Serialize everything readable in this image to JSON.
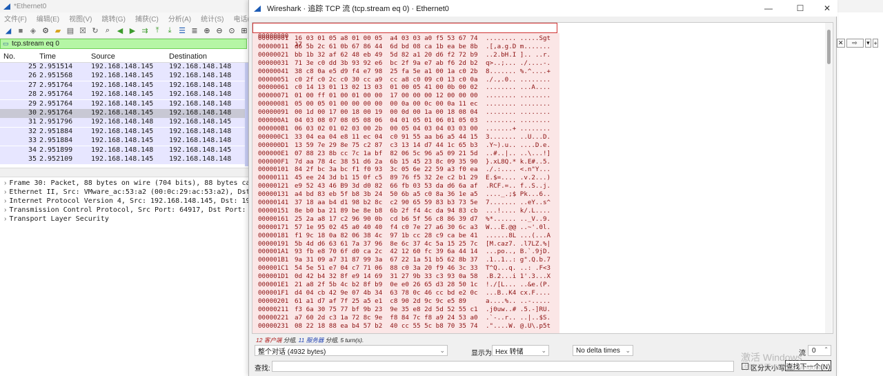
{
  "main": {
    "title": "*Ethernet0",
    "menu": [
      "文件(F)",
      "编辑(E)",
      "视图(V)",
      "跳转(G)",
      "捕获(C)",
      "分析(A)",
      "统计(S)",
      "电话(Y)",
      "无线"
    ],
    "filter": "tcp.stream eq 0",
    "columns": {
      "no": "No.",
      "time": "Time",
      "source": "Source",
      "destination": "Destination"
    },
    "packets": [
      {
        "no": "25",
        "time": "2.951514",
        "src": "192.168.148.145",
        "dst": "192.168.148.148"
      },
      {
        "no": "26",
        "time": "2.951568",
        "src": "192.168.148.145",
        "dst": "192.168.148.148"
      },
      {
        "no": "27",
        "time": "2.951764",
        "src": "192.168.148.145",
        "dst": "192.168.148.148"
      },
      {
        "no": "28",
        "time": "2.951764",
        "src": "192.168.148.145",
        "dst": "192.168.148.148"
      },
      {
        "no": "29",
        "time": "2.951764",
        "src": "192.168.148.145",
        "dst": "192.168.148.148"
      },
      {
        "no": "30",
        "time": "2.951764",
        "src": "192.168.148.145",
        "dst": "192.168.148.148"
      },
      {
        "no": "31",
        "time": "2.951796",
        "src": "192.168.148.148",
        "dst": "192.168.148.145"
      },
      {
        "no": "32",
        "time": "2.951884",
        "src": "192.168.148.145",
        "dst": "192.168.148.148"
      },
      {
        "no": "33",
        "time": "2.951884",
        "src": "192.168.148.145",
        "dst": "192.168.148.148"
      },
      {
        "no": "34",
        "time": "2.951899",
        "src": "192.168.148.148",
        "dst": "192.168.148.145"
      },
      {
        "no": "35",
        "time": "2.952109",
        "src": "192.168.148.145",
        "dst": "192.168.148.148"
      }
    ],
    "details": [
      "Frame 30: Packet, 88 bytes on wire (704 bits), 88 bytes captured",
      "Ethernet II, Src: VMware_ac:53:a2 (00:0c:29:ac:53:a2), Dst: VMwa",
      "Internet Protocol Version 4, Src: 192.168.148.145, Dst: 192.168.",
      "Transmission Control Protocol, Src Port: 64917, Dst Port: 8457,",
      "Transport Layer Security"
    ]
  },
  "dialog": {
    "title": "Wireshark · 追踪 TCP 流 (tcp.stream eq 0) · Ethernet0",
    "first_row": {
      "offset": "00000000",
      "hex": "17",
      "ascii": ""
    },
    "hex_rows": [
      {
        "offset": "00000001",
        "hex": "16 03 01 05 a8 01 00 05  a4 03 03 a0 f5 53 67 74",
        "ascii": "........ .....Sgt"
      },
      {
        "offset": "00000011",
        "hex": "d6 5b 2c 61 0b 67 86 44  6d bd 08 ca 1b ea be 8b",
        "ascii": ".[,a.g.D m......."
      },
      {
        "offset": "00000021",
        "hex": "bb 1b 32 af 62 48 eb 49  5d 82 a1 20 d6 f2 72 b9",
        "ascii": "..2.bH.I ].. ..r."
      },
      {
        "offset": "00000031",
        "hex": "71 3e c0 dd 3b 93 92 e6  bc 2f 9a e7 ab f6 2d b2",
        "ascii": "q>..;... ./....-."
      },
      {
        "offset": "00000041",
        "hex": "38 c8 0a e5 d9 f4 e7 98  25 fa 5e a1 00 1a c0 2b",
        "ascii": "8....... %.^....+"
      },
      {
        "offset": "00000051",
        "hex": "c0 2f c0 2c c0 30 cc a9  cc a8 c0 09 c0 13 c0 0a",
        "ascii": "./.,.0.. ........"
      },
      {
        "offset": "00000061",
        "hex": "c0 14 13 01 13 02 13 03  01 00 05 41 00 0b 00 02",
        "ascii": "........ ...A...."
      },
      {
        "offset": "00000071",
        "hex": "01 00 ff 01 00 01 00 00  17 00 00 00 12 00 00 00",
        "ascii": "........ ........"
      },
      {
        "offset": "00000081",
        "hex": "05 00 05 01 00 00 00 00  00 0a 00 0c 00 0a 11 ec",
        "ascii": "........ ........"
      },
      {
        "offset": "00000091",
        "hex": "00 1d 00 17 00 18 00 19  00 0d 00 1a 00 18 08 04",
        "ascii": "........ ........"
      },
      {
        "offset": "000000A1",
        "hex": "04 03 08 07 08 05 08 06  04 01 05 01 06 01 05 03",
        "ascii": "........ ........"
      },
      {
        "offset": "000000B1",
        "hex": "06 03 02 01 02 03 00 2b  00 05 04 03 04 03 03 00",
        "ascii": ".......+ ........"
      },
      {
        "offset": "000000C1",
        "hex": "33 04 ea 04 e8 11 ec 04  c0 91 55 aa b6 a5 44 15",
        "ascii": "3....... ..U...D."
      },
      {
        "offset": "000000D1",
        "hex": "13 59 7e 29 8e 75 c2 87  c3 13 14 d7 44 1c 65 b3",
        "ascii": ".Y~).u.. ....D.e."
      },
      {
        "offset": "000000E1",
        "hex": "07 88 23 8b cc 7c 1a bf  82 06 5c 96 a5 09 21 5d",
        "ascii": "..#..|.. ..\\...!]"
      },
      {
        "offset": "000000F1",
        "hex": "7d aa 78 4c 38 51 d6 2a  6b 15 45 23 8c 09 35 90",
        "ascii": "}.xL8Q.* k.E#..5."
      },
      {
        "offset": "00000101",
        "hex": "84 2f bc 3a bc f1 f0 93  3c 05 6e 22 59 a3 f0 ea",
        "ascii": "./.:.... <.n\"Y..."
      },
      {
        "offset": "00000111",
        "hex": "45 ee 24 3d b1 15 0f c5  89 76 f5 32 2e c2 b1 29",
        "ascii": "E.$=.... .v.2...)"
      },
      {
        "offset": "00000121",
        "hex": "e9 52 43 46 B9 3d d0 82  66 fb 03 53 da d6 6a af",
        "ascii": ".RCF.=.. f..S..j."
      },
      {
        "offset": "00000131",
        "hex": "a4 bd 83 eb 5f b8 3b 24  50 6b a5 c0 8a 36 1e a5",
        "ascii": "...._.;$ Pk...6.."
      },
      {
        "offset": "00000141",
        "hex": "37 18 aa b4 d1 98 b2 8c  c2 90 65 59 83 b3 73 5e",
        "ascii": "7....... ..eY..s^"
      },
      {
        "offset": "00000151",
        "hex": "8e b0 ba 21 89 be 8e b8  6b 2f f4 4c da 94 83 cb",
        "ascii": "...!.... k/.L...."
      },
      {
        "offset": "00000161",
        "hex": "25 2a a8 17 c2 96 90 0b  cd b6 5f 56 c8 86 39 d7",
        "ascii": "%*...... .._V..9."
      },
      {
        "offset": "00000171",
        "hex": "57 1e 95 02 45 a0 40 40  f4 c0 7e 27 a6 30 6c a3",
        "ascii": "W...E.@@ ..~'.0l."
      },
      {
        "offset": "00000181",
        "hex": "f1 9c 18 0a 82 06 38 4c  97 1b cc 28 c9 ca be 41",
        "ascii": "......8L ...(...A"
      },
      {
        "offset": "00000191",
        "hex": "5b 4d d6 63 61 7a 37 96  8e 6c 37 4c 5a 15 25 7c",
        "ascii": "[M.caz7. .l7LZ.%|"
      },
      {
        "offset": "000001A1",
        "hex": "93 fb e8 70 6f d0 ca 2c  42 12 60 fc 39 6a 44 14",
        "ascii": "...po.., B.`.9jD."
      },
      {
        "offset": "000001B1",
        "hex": "9a 31 09 a7 31 87 99 3a  67 22 1a 51 b5 62 8b 37",
        "ascii": ".1..1..: g\".Q.b.7"
      },
      {
        "offset": "000001C1",
        "hex": "54 5e 51 e7 04 c7 71 06  88 c0 3a 20 f9 46 3c 33",
        "ascii": "T^Q...q. ..: .F<3"
      },
      {
        "offset": "000001D1",
        "hex": "0d 42 b4 32 8f e9 14 69  31 27 9b 33 c3 93 0a 58",
        "ascii": ".B.2...i 1'.3...X"
      },
      {
        "offset": "000001E1",
        "hex": "21 a8 2f 5b 4c b2 8f b9  0e e0 26 65 d3 28 50 1c",
        "ascii": "!./[L... ..&e.(P."
      },
      {
        "offset": "000001F1",
        "hex": "d4 04 cb 42 9e 07 4b 34  63 78 0c 46 cc bd e2 0c",
        "ascii": "...B..K4 cx.F...."
      },
      {
        "offset": "00000201",
        "hex": "61 a1 d7 af 7f 25 a5 e1  c8 90 2d 9c 9c e5 89",
        "ascii": "a....%.. ..-....."
      },
      {
        "offset": "00000211",
        "hex": "f3 6a 30 75 77 bf 9b 23  9e 35 e8 2d 5d 52 55 c1",
        "ascii": ".j0uw..# .5.-]RU."
      },
      {
        "offset": "00000221",
        "hex": "a7 60 2d c3 1a 72 8c 9e  f8 84 7c f8 a9 24 53 a0",
        "ascii": ".`-..r.. ..|..$S."
      },
      {
        "offset": "00000231",
        "hex": "08 22 18 88 ea b4 57 b2  40 cc 55 5c b8 70 35 74",
        "ascii": ".\"....W. @.U\\.p5t"
      }
    ],
    "summary": {
      "client_count": "12",
      "client_label": "客户端",
      "client_suffix": "分组,",
      "server_count": "11",
      "server_label": "服务器",
      "server_suffix": "分组,",
      "turns": "5 turn(s)."
    },
    "conversation_label": "整个对话 (4932 bytes)",
    "show_as_label": "显示为",
    "show_as_value": "Hex 转储",
    "delta_value": "No delta times",
    "stream_label": "流",
    "stream_value": "0",
    "find_label": "查找:",
    "case_label": "区分大小写",
    "find_next_label": "查找下一个(N)"
  },
  "watermark": {
    "line1": "激活 Windows",
    "line2": "转到\"设置\"以激活 Windows。"
  }
}
